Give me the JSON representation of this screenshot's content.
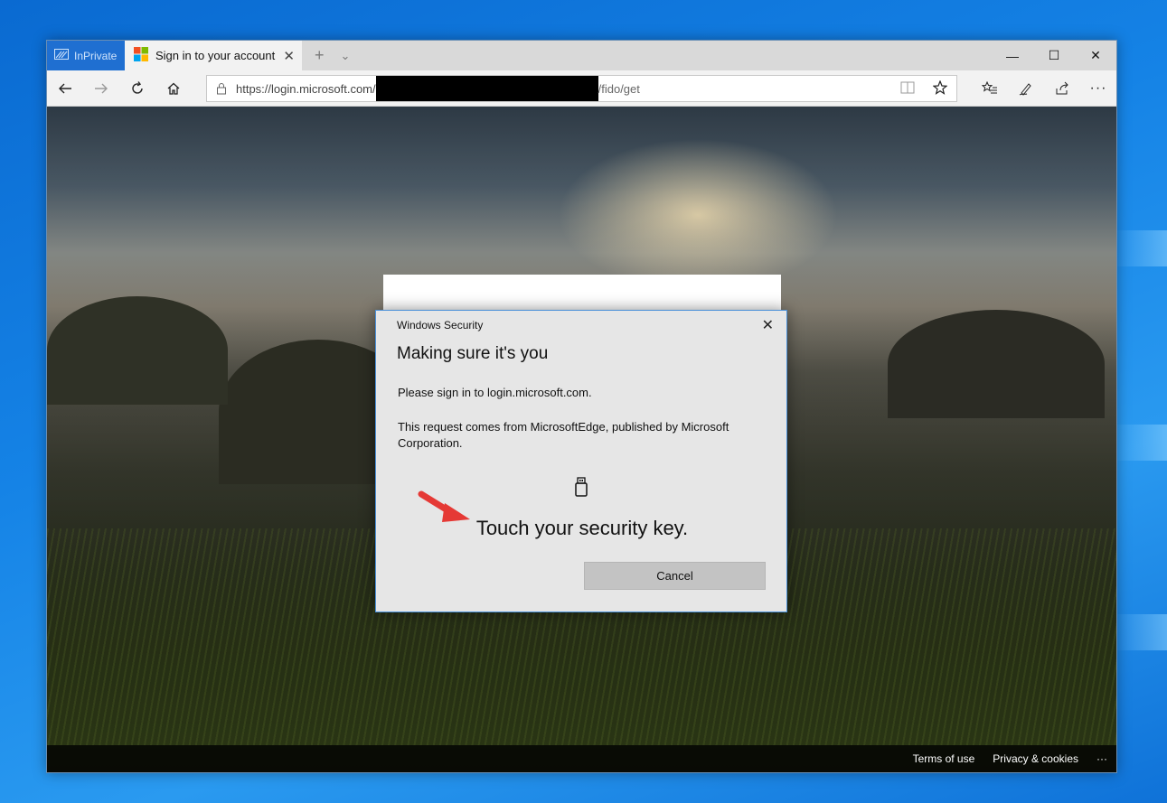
{
  "browser": {
    "inprivate_label": "InPrivate",
    "tab_title": "Sign in to your account",
    "url_prefix": "https://login.microsoft.com/",
    "url_suffix": "/fido/get"
  },
  "footer": {
    "links": [
      "Terms of use",
      "Privacy & cookies"
    ],
    "more": "···"
  },
  "dialog": {
    "app_name": "Windows Security",
    "title": "Making sure it's you",
    "message1": "Please sign in to login.microsoft.com.",
    "message2": "This request comes from MicrosoftEdge, published by Microsoft Corporation.",
    "instruction": "Touch your security key.",
    "cancel_label": "Cancel"
  },
  "colors": {
    "inprivate_accent": "#1f6fd1",
    "annotation_arrow": "#e53935",
    "dialog_border": "#4a90d9"
  }
}
